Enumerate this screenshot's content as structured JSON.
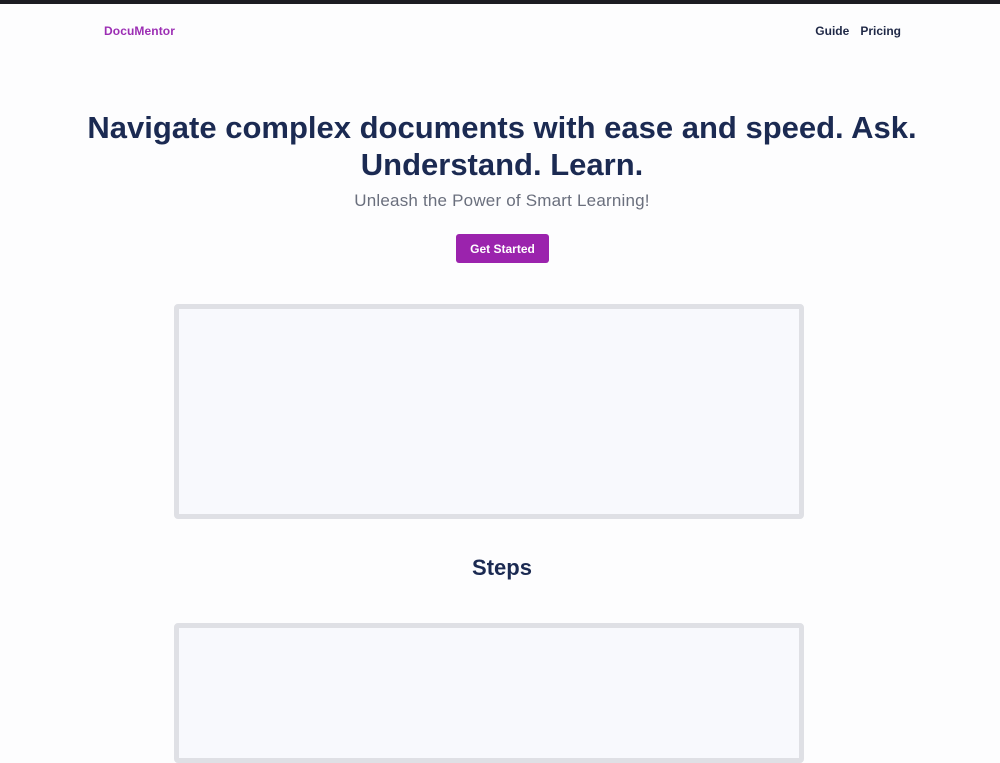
{
  "header": {
    "brand": "DocuMentor",
    "nav": [
      {
        "label": "Guide"
      },
      {
        "label": "Pricing"
      }
    ]
  },
  "hero": {
    "title": "Navigate complex documents with ease and speed. Ask. Understand. Learn.",
    "subtitle": "Unleash the Power of Smart Learning!",
    "cta_label": "Get Started"
  },
  "steps_section": {
    "heading": "Steps"
  },
  "colors": {
    "brand": "#9c2eb4",
    "accent_button": "#9b23ad",
    "heading_text": "#1b2a52",
    "frame_border": "#dfe0e5",
    "frame_fill": "#f8f9fd"
  }
}
